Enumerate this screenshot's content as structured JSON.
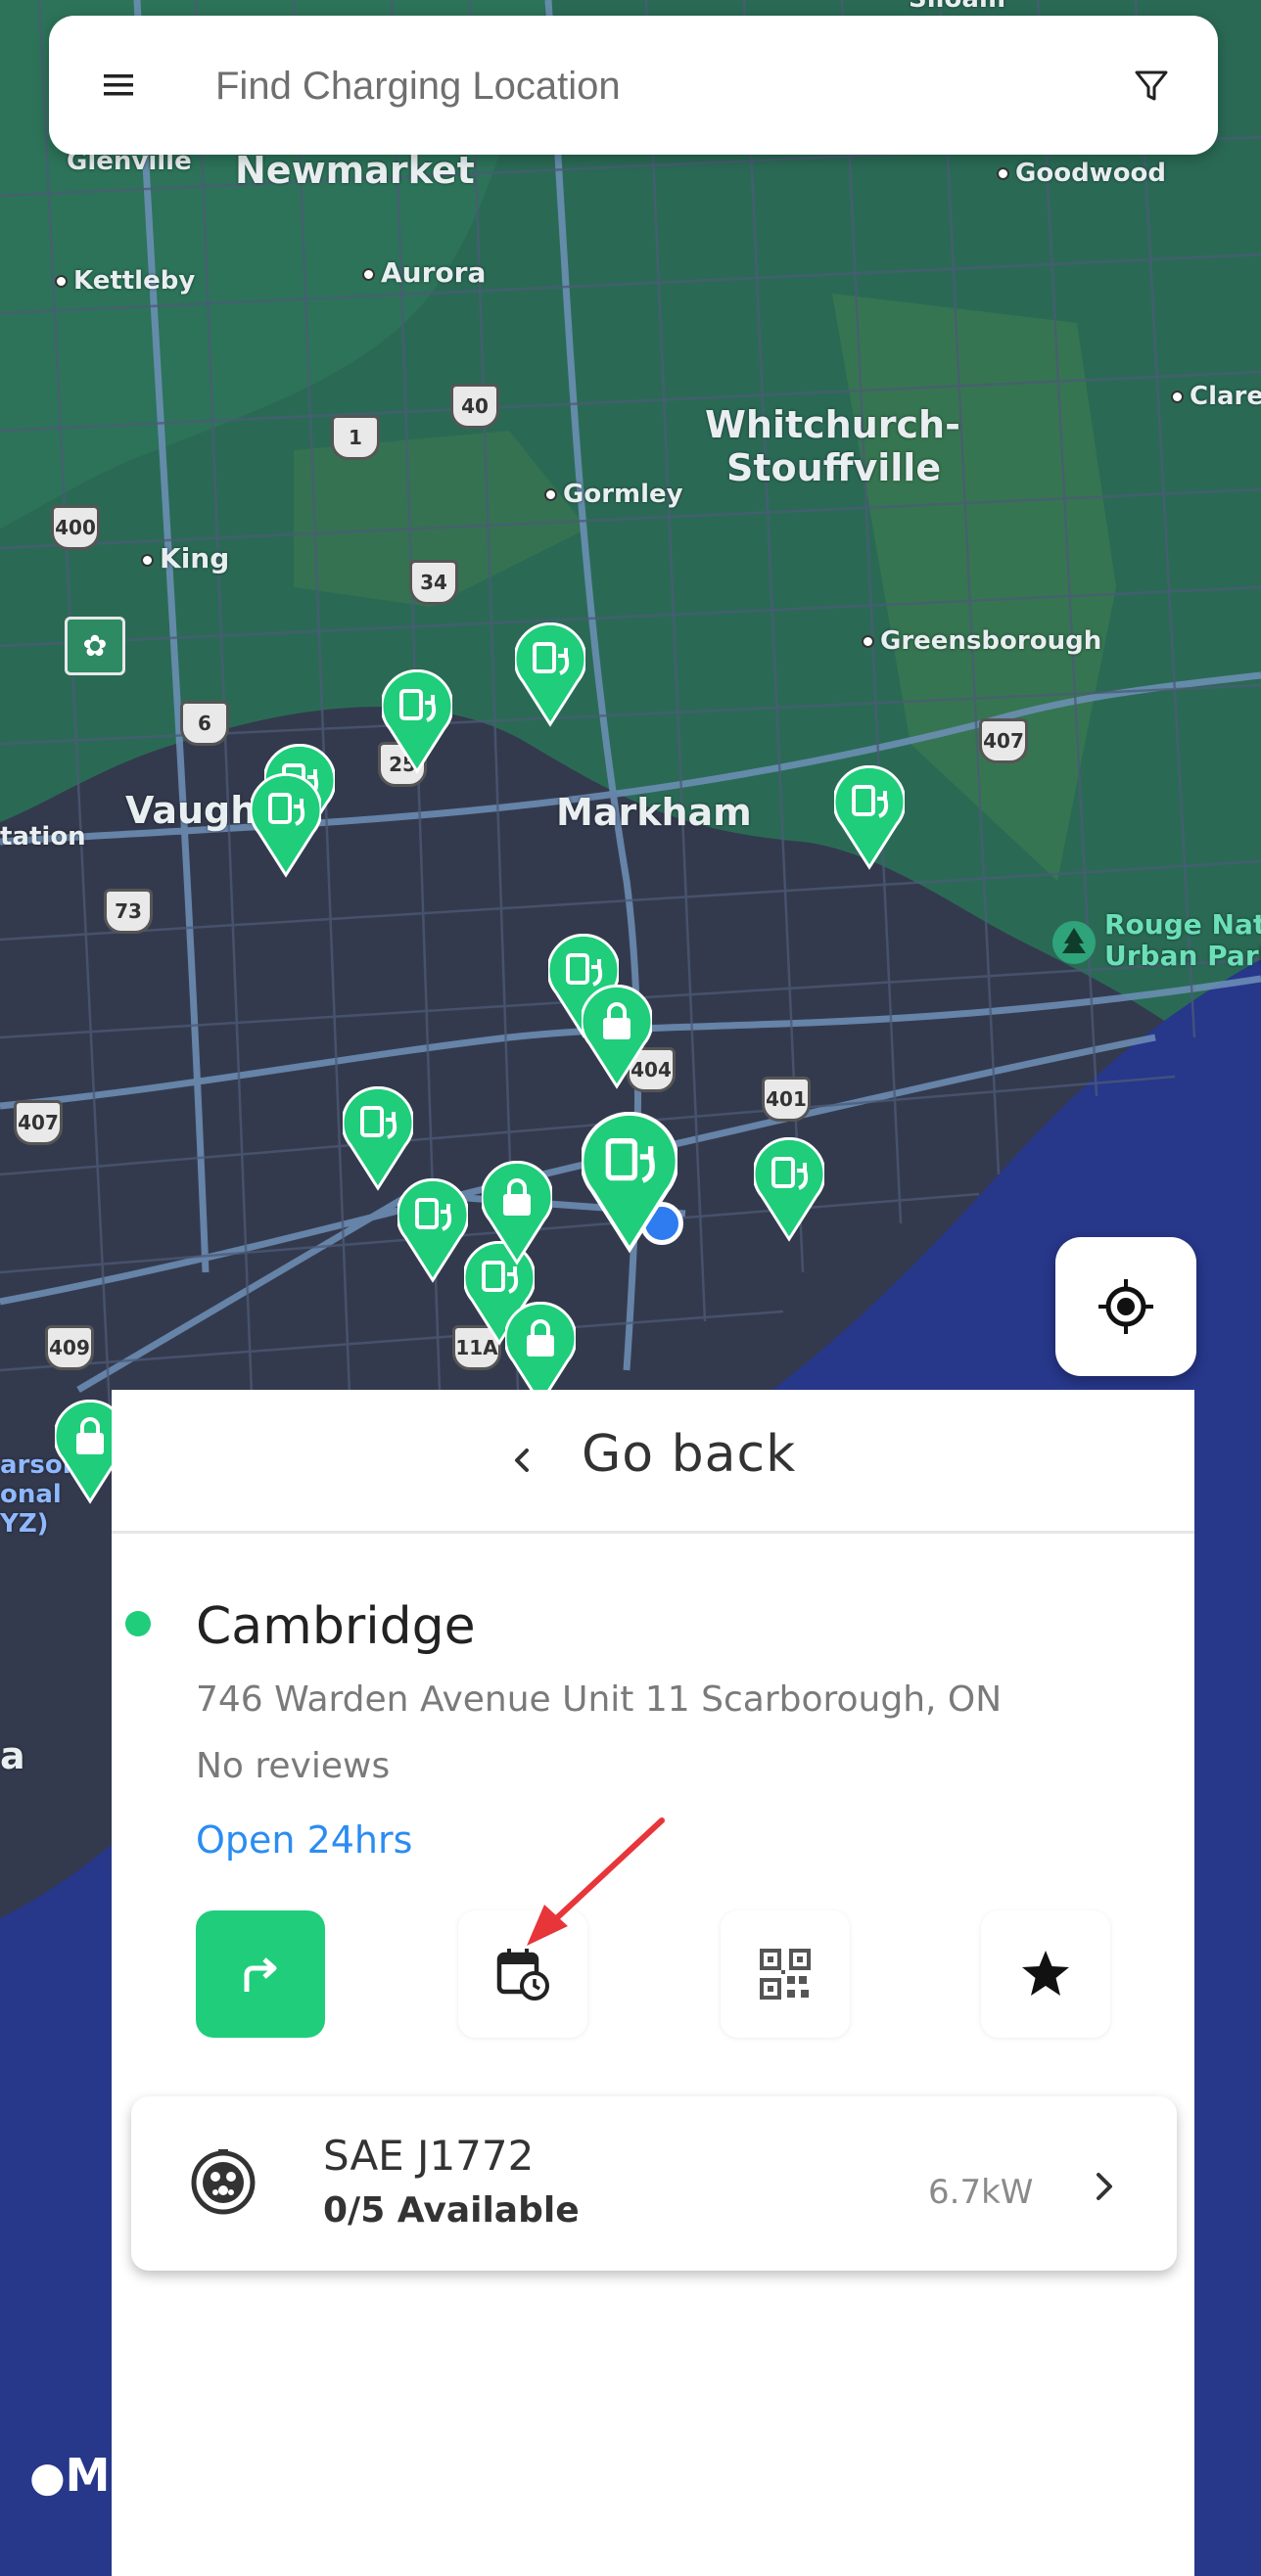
{
  "search": {
    "placeholder": "Find Charging Location"
  },
  "icons": {
    "menu": "menu-icon",
    "filter": "filter-icon",
    "locate": "crosshair-icon",
    "back": "chevron-left-icon",
    "directions": "turn-right-arrow-icon",
    "schedule": "calendar-clock-icon",
    "qr": "qr-code-icon",
    "favorite": "star-icon",
    "connector": "j1772-plug-icon",
    "connector_chevron": "chevron-right-icon",
    "apple_logo": "apple-logo-icon"
  },
  "colors": {
    "accent_green": "#1fcd7b",
    "link_blue": "#2b8cf2",
    "water": "#27378a",
    "land": "#2a6a55",
    "urban": "#343a4d",
    "annotation_arrow": "#e8353a"
  },
  "map": {
    "labels": {
      "siloam": "Siloam",
      "glenville": "Glenville",
      "newmarket": "Newmarket",
      "goodwood": "Goodwood",
      "kettleby": "Kettleby",
      "aurora": "Aurora",
      "whitchurch1": "Whitchurch-",
      "whitchurch2": "Stouffville",
      "claremont": "Clare",
      "gormley": "Gormley",
      "king": "King",
      "greensborough": "Greensborough",
      "vaughan": "Vaugh",
      "markham": "Markham",
      "station": "tation",
      "rouge1": "Rouge Nati",
      "rouge2": "Urban Park",
      "pearson1": "arson",
      "pearson2": "onal",
      "pearson3": "YZ)",
      "etobicoke": "a"
    },
    "shields": [
      "400",
      "1",
      "40",
      "34",
      "6",
      "25",
      "73",
      "407",
      "407",
      "404",
      "401",
      "409",
      "11A"
    ],
    "attribution": "Maps"
  },
  "panel": {
    "go_back": "Go back",
    "station": {
      "name": "Cambridge",
      "address": "746 Warden Avenue Unit 11 Scarborough, ON",
      "reviews": "No reviews",
      "hours": "Open 24hrs"
    },
    "connector": {
      "type": "SAE J1772",
      "availability": "0/5 Available",
      "power": "6.7kW"
    }
  }
}
